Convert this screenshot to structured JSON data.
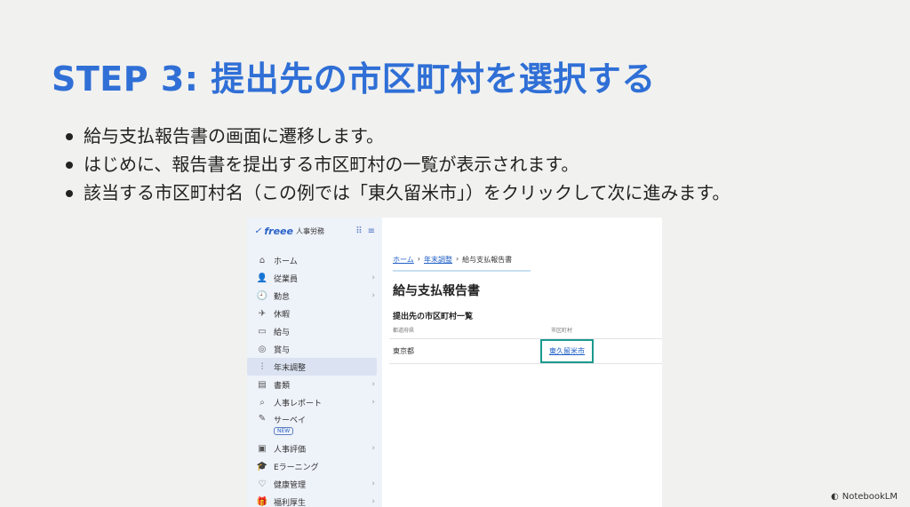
{
  "title": "STEP 3: 提出先の市区町村を選択する",
  "bullets": [
    "給与支払報告書の画面に遷移します。",
    "はじめに、報告書を提出する市区町村の一覧が表示されます。",
    "該当する市区町村名（この例では「東久留米市」）をクリックして次に進みます。"
  ],
  "screenshot": {
    "logo": {
      "mark": "✓",
      "brand": "freee",
      "product": "人事労務"
    },
    "nav": [
      {
        "label": "ホーム",
        "icon": "home-icon",
        "glyph": "⌂",
        "chevron": false
      },
      {
        "label": "従業員",
        "icon": "employee-icon",
        "glyph": "👤",
        "chevron": true
      },
      {
        "label": "勤怠",
        "icon": "attendance-icon",
        "glyph": "🕘",
        "chevron": true
      },
      {
        "label": "休暇",
        "icon": "leave-icon",
        "glyph": "✈",
        "chevron": false
      },
      {
        "label": "給与",
        "icon": "salary-icon",
        "glyph": "▭",
        "chevron": false
      },
      {
        "label": "賞与",
        "icon": "bonus-icon",
        "glyph": "◎",
        "chevron": false
      },
      {
        "label": "年末調整",
        "icon": "year-end-icon",
        "glyph": "⫶",
        "chevron": false
      },
      {
        "label": "書類",
        "icon": "document-icon",
        "glyph": "▤",
        "chevron": true
      },
      {
        "label": "人事レポート",
        "icon": "report-icon",
        "glyph": "⌕",
        "chevron": true
      },
      {
        "label": "サーベイ",
        "icon": "survey-icon",
        "glyph": "✎",
        "chevron": false,
        "badge": "NEW"
      },
      {
        "label": "人事評価",
        "icon": "evaluation-icon",
        "glyph": "▣",
        "chevron": true
      },
      {
        "label": "Eラーニング",
        "icon": "elearning-icon",
        "glyph": "🎓",
        "chevron": false
      },
      {
        "label": "健康管理",
        "icon": "health-icon",
        "glyph": "♡",
        "chevron": true
      },
      {
        "label": "福利厚生",
        "icon": "welfare-icon",
        "glyph": "🎁",
        "chevron": true
      }
    ],
    "breadcrumb": {
      "home": "ホーム",
      "sep": "›",
      "year_end": "年末調整",
      "current": "給与支払報告書"
    },
    "page_title": "給与支払報告書",
    "section_title": "提出先の市区町村一覧",
    "table": {
      "headers": [
        "都道府県",
        "市区町村"
      ],
      "rows": [
        [
          "東京都",
          "東久留米市"
        ]
      ]
    }
  },
  "brand": "NotebookLM"
}
